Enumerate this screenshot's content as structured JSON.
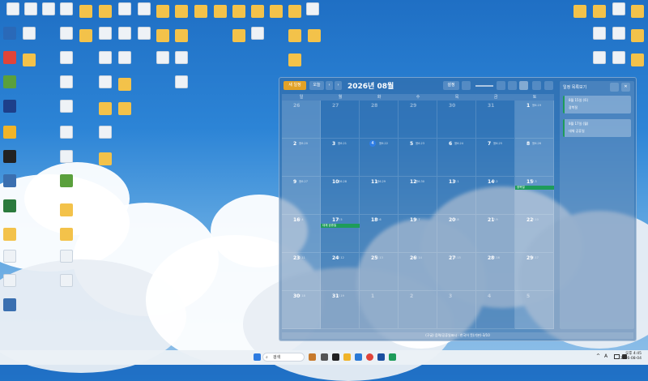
{
  "taskbar": {
    "search_placeholder": "검색",
    "time": "오후 4:45",
    "date": "2026-08-04"
  },
  "calendar": {
    "toolbar": {
      "btn_add": "새 일정",
      "btn_today": "오늘",
      "prev": "‹",
      "next": "›",
      "title": "2026년 08월",
      "btn_settings": "설정"
    },
    "weekdays": [
      "일",
      "월",
      "화",
      "수",
      "목",
      "금",
      "토"
    ],
    "weeks": [
      [
        {
          "n": "26",
          "l": "",
          "dim": true
        },
        {
          "n": "27",
          "l": "",
          "dim": true
        },
        {
          "n": "28",
          "l": "",
          "dim": true
        },
        {
          "n": "29",
          "l": "",
          "dim": true
        },
        {
          "n": "30",
          "l": "",
          "dim": true
        },
        {
          "n": "31",
          "l": "",
          "dim": true
        },
        {
          "n": "1",
          "l": "윤6.19"
        }
      ],
      [
        {
          "n": "2",
          "l": "윤6.20"
        },
        {
          "n": "3",
          "l": "윤6.21"
        },
        {
          "n": "4",
          "l": "윤6.22",
          "today": true
        },
        {
          "n": "5",
          "l": "윤6.23"
        },
        {
          "n": "6",
          "l": "윤6.24"
        },
        {
          "n": "7",
          "l": "윤6.25"
        },
        {
          "n": "8",
          "l": "윤6.26"
        }
      ],
      [
        {
          "n": "9",
          "l": "윤6.27"
        },
        {
          "n": "10",
          "l": "윤6.28"
        },
        {
          "n": "11",
          "l": "윤6.29"
        },
        {
          "n": "12",
          "l": "윤6.30"
        },
        {
          "n": "13",
          "l": "7.1"
        },
        {
          "n": "14",
          "l": "7.2"
        },
        {
          "n": "15",
          "l": "7.3"
        }
      ],
      [
        {
          "n": "16",
          "l": "7.4"
        },
        {
          "n": "17",
          "l": "7.5"
        },
        {
          "n": "18",
          "l": "7.6"
        },
        {
          "n": "19",
          "l": "7.7"
        },
        {
          "n": "20",
          "l": "7.8"
        },
        {
          "n": "21",
          "l": "7.9"
        },
        {
          "n": "22",
          "l": "7.10"
        }
      ],
      [
        {
          "n": "23",
          "l": "7.11"
        },
        {
          "n": "24",
          "l": "7.12"
        },
        {
          "n": "25",
          "l": "7.13"
        },
        {
          "n": "26",
          "l": "7.14"
        },
        {
          "n": "27",
          "l": "7.15"
        },
        {
          "n": "28",
          "l": "7.16"
        },
        {
          "n": "29",
          "l": "7.17"
        }
      ],
      [
        {
          "n": "30",
          "l": "7.18"
        },
        {
          "n": "31",
          "l": "7.19"
        },
        {
          "n": "1",
          "l": "",
          "dim": true
        },
        {
          "n": "2",
          "l": "",
          "dim": true
        },
        {
          "n": "3",
          "l": "",
          "dim": true
        },
        {
          "n": "4",
          "l": "",
          "dim": true
        },
        {
          "n": "5",
          "l": "",
          "dim": true
        }
      ]
    ],
    "events": [
      {
        "label": "광복절",
        "week": 2,
        "col": 6
      },
      {
        "label": "대체 공휴일",
        "week": 3,
        "col": 1
      }
    ],
    "status_text": "(구글) 음력/공휴일표시 · 한국어 뜻(기본)-3/10",
    "side_panel": {
      "title": "일정 목록보기",
      "items": [
        {
          "date": "8월 15일 (토)",
          "title": "광복절"
        },
        {
          "date": "8월 17일 (월)",
          "title": "대체 공휴일"
        }
      ]
    }
  },
  "colors": {
    "event": "#1e9c5a",
    "today": "#2f7ee6"
  }
}
